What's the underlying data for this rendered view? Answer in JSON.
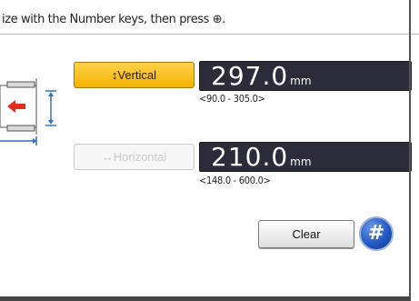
{
  "instruction": "ize with the Number keys, then press ⊕.",
  "vertical": {
    "label": "↕Vertical",
    "value": "297.0",
    "unit": "mm",
    "range": "<90.0 - 305.0>",
    "selected": true
  },
  "horizontal": {
    "label": "↔Horizontal",
    "value": "210.0",
    "unit": "mm",
    "range": "<148.0 - 600.0>",
    "selected": false
  },
  "clear_label": "Clear",
  "hash_key_label": "#",
  "colors": {
    "selected_button": "#f3b400",
    "value_display": "#2b2b3a",
    "hash_button": "#1f55bf",
    "tray_arrow": "#e22a1e"
  }
}
